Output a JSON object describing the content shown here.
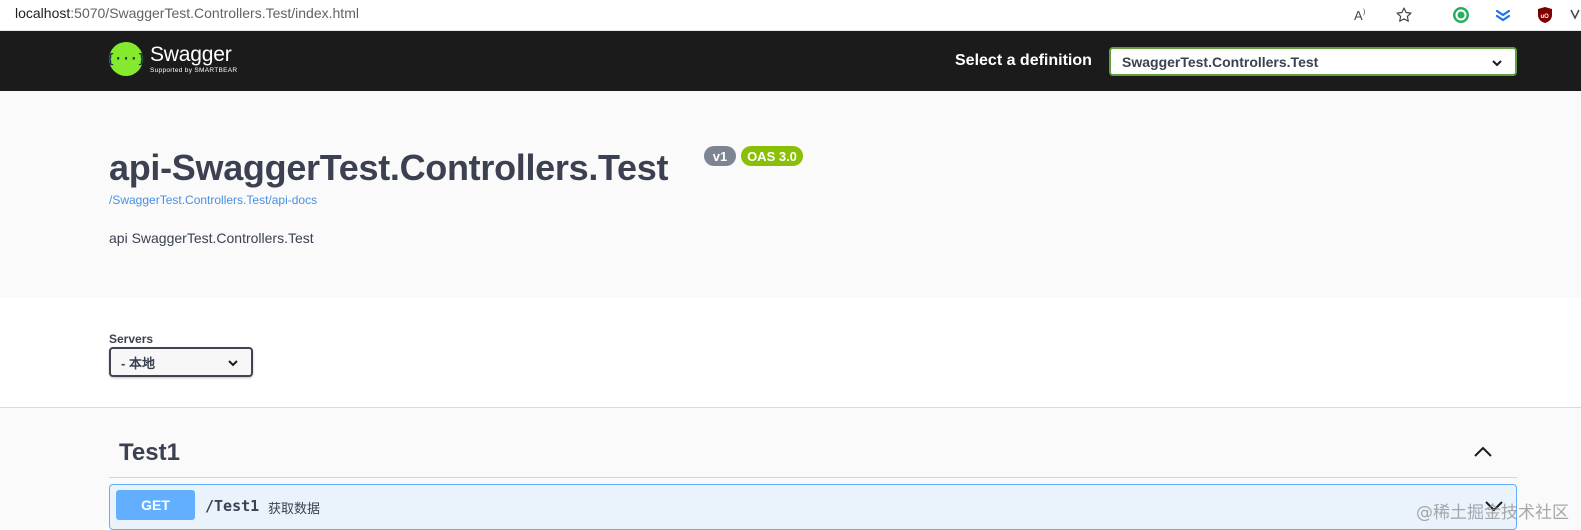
{
  "browser": {
    "url_host": "localhost",
    "url_rest": ":5070/SwaggerTest.Controllers.Test/index.html",
    "icons": [
      "read-aloud-icon",
      "favorite-star-icon",
      "extension-green-icon",
      "extension-blue-icon",
      "ublock-icon"
    ]
  },
  "topbar": {
    "logo_title": "Swagger",
    "logo_subtitle": "Supported by SMARTBEAR",
    "logo_glyph": "{···}",
    "select_definition_label": "Select a definition",
    "definition_selected": "SwaggerTest.Controllers.Test"
  },
  "info": {
    "title": "api-SwaggerTest.Controllers.Test",
    "version_badge": "v1",
    "oas_badge": "OAS 3.0",
    "spec_url": "/SwaggerTest.Controllers.Test/api-docs",
    "description": "api SwaggerTest.Controllers.Test"
  },
  "servers": {
    "label": "Servers",
    "selected": "- 本地"
  },
  "operations": {
    "tag": "Test1",
    "items": [
      {
        "method": "GET",
        "path": "/Test1",
        "summary": "获取数据"
      }
    ]
  },
  "watermark": "@稀土掘金技术社区",
  "colors": {
    "topbar_bg": "#1b1b1b",
    "swagger_green": "#85ea2d",
    "get_blue": "#61affe",
    "version_badge": "#7d8492",
    "oas_badge": "#89bf04",
    "link": "#4990e2"
  }
}
